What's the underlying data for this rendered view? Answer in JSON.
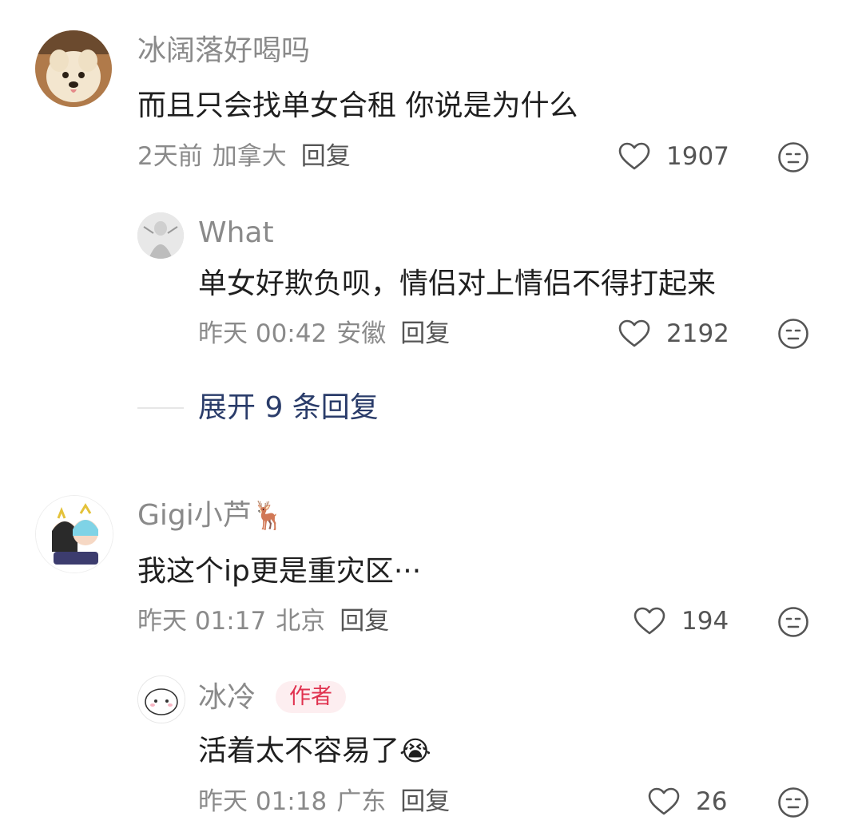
{
  "comments": [
    {
      "user": "冰阔落好喝吗",
      "text": "而且只会找单女合租 你说是为什么",
      "time": "2天前",
      "location": "加拿大",
      "reply_label": "回复",
      "likes": "1907",
      "replies": [
        {
          "user": "What",
          "text": "单女好欺负呗，情侣对上情侣不得打起来",
          "time": "昨天 00:42",
          "location": "安徽",
          "reply_label": "回复",
          "likes": "2192"
        }
      ],
      "expand_label": "展开 9 条回复"
    },
    {
      "user": "Gigi小芦",
      "user_emoji": "🦌",
      "text": "我这个ip更是重灾区···",
      "time": "昨天 01:17",
      "location": "北京",
      "reply_label": "回复",
      "likes": "194",
      "replies": [
        {
          "user": "冰冷",
          "badge": "作者",
          "text": "活着太不容易了",
          "text_emoji": "😭",
          "time": "昨天 01:18",
          "location": "广东",
          "reply_label": "回复",
          "likes": "26"
        }
      ]
    }
  ],
  "colors": {
    "meta": "#8a8a8a",
    "text": "#1f1f1f",
    "expand": "#2a3c6a",
    "badge_bg": "#fdeef0",
    "badge_text": "#e0324f"
  },
  "icons": {
    "like": "heart-outline-icon",
    "react": "neutral-face-icon"
  }
}
